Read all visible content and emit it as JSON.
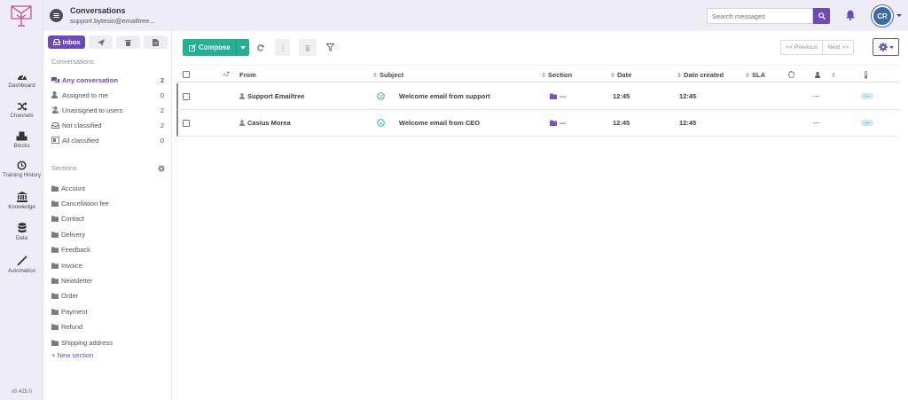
{
  "app": {
    "title": "Conversations",
    "account": "support.bytesin@emailtree...",
    "version": "v0.425.0"
  },
  "rail": [
    {
      "label": "Dashboard",
      "icon": "dashboard-icon"
    },
    {
      "label": "Channels",
      "icon": "shuffle-icon"
    },
    {
      "label": "Blocks",
      "icon": "cubes-icon"
    },
    {
      "label": "Training History",
      "icon": "history-icon"
    },
    {
      "label": "Knowledge",
      "icon": "bank-icon"
    },
    {
      "label": "Data",
      "icon": "database-icon"
    },
    {
      "label": "Automation",
      "icon": "magic-wand-icon"
    }
  ],
  "tabs": {
    "inbox": "Inbox"
  },
  "conversations": {
    "heading": "Conversations",
    "items": [
      {
        "label": "Any conversation",
        "count": "2"
      },
      {
        "label": "Assigned to me",
        "count": "0"
      },
      {
        "label": "Unassigned to users",
        "count": "2"
      },
      {
        "label": "Not classified",
        "count": "2"
      },
      {
        "label": "All classified",
        "count": "0"
      }
    ]
  },
  "sections": {
    "heading": "Sections",
    "items": [
      "Account",
      "Cancellation fee",
      "Contact",
      "Delivery",
      "Feedback",
      "Invoice",
      "Newsletter",
      "Order",
      "Payment",
      "Refund",
      "Shipping address"
    ],
    "new_label": "+ New section"
  },
  "topbar": {
    "search_placeholder": "Search messages",
    "avatar": "CR"
  },
  "toolbar": {
    "compose": "Compose",
    "previous": "<< Previous",
    "next": "Next >>"
  },
  "table": {
    "columns": {
      "from": "From",
      "subject": "Subject",
      "section": "Section",
      "date": "Date",
      "date_created": "Date created",
      "sla": "SLA"
    },
    "rows": [
      {
        "from": "Support Emailtree",
        "subject": "Welcome email from support",
        "section": "---",
        "date": "12:45",
        "date_created": "12:45",
        "assignee": "---",
        "tag": "..."
      },
      {
        "from": "Casius Morea",
        "subject": "Welcome email from CEO",
        "section": "---",
        "date": "12:45",
        "date_created": "12:45",
        "assignee": "---",
        "tag": "..."
      }
    ]
  },
  "colors": {
    "accent": "#6e4ab8",
    "compose": "#23b093",
    "avatar": "#3c6aa8"
  }
}
